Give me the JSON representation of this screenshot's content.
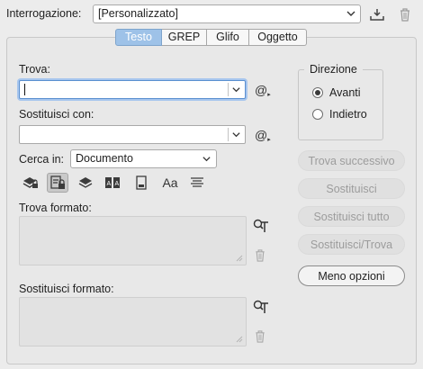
{
  "query": {
    "label": "Interrogazione:",
    "value": "[Personalizzato]",
    "save_icon": "save-query-icon",
    "delete_icon": "trash-icon"
  },
  "tabs": [
    {
      "label": "Testo",
      "active": true
    },
    {
      "label": "GREP",
      "active": false
    },
    {
      "label": "Glifo",
      "active": false
    },
    {
      "label": "Oggetto",
      "active": false
    }
  ],
  "find": {
    "label": "Trova:",
    "value": "",
    "special_char_icon": "at-sign-icon"
  },
  "replace": {
    "label": "Sostituisci con:",
    "value": "",
    "special_char_icon": "at-sign-icon"
  },
  "search_in": {
    "label": "Cerca in:",
    "value": "Documento"
  },
  "options_icons": [
    {
      "name": "locked-layers-icon",
      "active": false
    },
    {
      "name": "locked-stories-icon",
      "active": true
    },
    {
      "name": "hidden-layers-icon",
      "active": false
    },
    {
      "name": "master-pages-icon",
      "active": false
    },
    {
      "name": "footnotes-icon",
      "active": false
    },
    {
      "name": "case-sensitive-icon",
      "active": false
    },
    {
      "name": "whole-word-icon",
      "active": false
    }
  ],
  "find_format": {
    "label": "Trova formato:"
  },
  "replace_format": {
    "label": "Sostituisci formato:"
  },
  "direction": {
    "label": "Direzione",
    "options": [
      {
        "label": "Avanti",
        "checked": true
      },
      {
        "label": "Indietro",
        "checked": false
      }
    ]
  },
  "buttons": {
    "find_next": "Trova successivo",
    "replace": "Sostituisci",
    "replace_all": "Sostituisci tutto",
    "replace_find": "Sostituisci/Trova",
    "fewer_options": "Meno opzioni"
  },
  "colors": {
    "active_tab": "#9ec2e8",
    "focus_ring": "#a7c6ee",
    "panel_bg": "#ececec"
  }
}
